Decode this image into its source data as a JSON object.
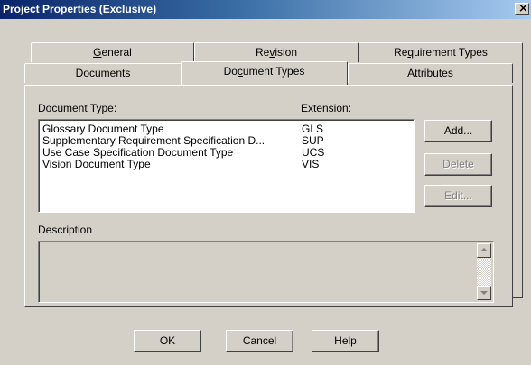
{
  "window": {
    "title": "Project Properties  (Exclusive)",
    "close_glyph": "×"
  },
  "tabs_back": [
    {
      "pre": "",
      "u": "G",
      "post": "eneral"
    },
    {
      "pre": "Re",
      "u": "v",
      "post": "ision"
    },
    {
      "pre": "Re",
      "u": "q",
      "post": "uirement Types"
    }
  ],
  "tabs_front": [
    {
      "pre": "D",
      "u": "o",
      "post": "cuments"
    },
    {
      "pre": "Do",
      "u": "c",
      "post": "ument Types"
    },
    {
      "pre": "Attri",
      "u": "b",
      "post": "utes"
    }
  ],
  "active_tab": "Document Types",
  "labels": {
    "document_type": "Document Type:",
    "extension": "Extension:",
    "description": "Description"
  },
  "document_types": [
    {
      "name": "Glossary Document Type",
      "extension": "GLS"
    },
    {
      "name": "Supplementary Requirement Specification D...",
      "extension": "SUP"
    },
    {
      "name": "Use Case Specification Document Type",
      "extension": "UCS"
    },
    {
      "name": "Vision Document Type",
      "extension": "VIS"
    }
  ],
  "side_buttons": {
    "add": "Add...",
    "delete": "Delete",
    "edit": "Edit..."
  },
  "description_value": "",
  "footer_buttons": {
    "ok": "OK",
    "cancel": "Cancel",
    "help": "Help"
  },
  "colors": {
    "face": "#d4d0c8",
    "title_start": "#0a246a",
    "title_end": "#a6caf0"
  }
}
